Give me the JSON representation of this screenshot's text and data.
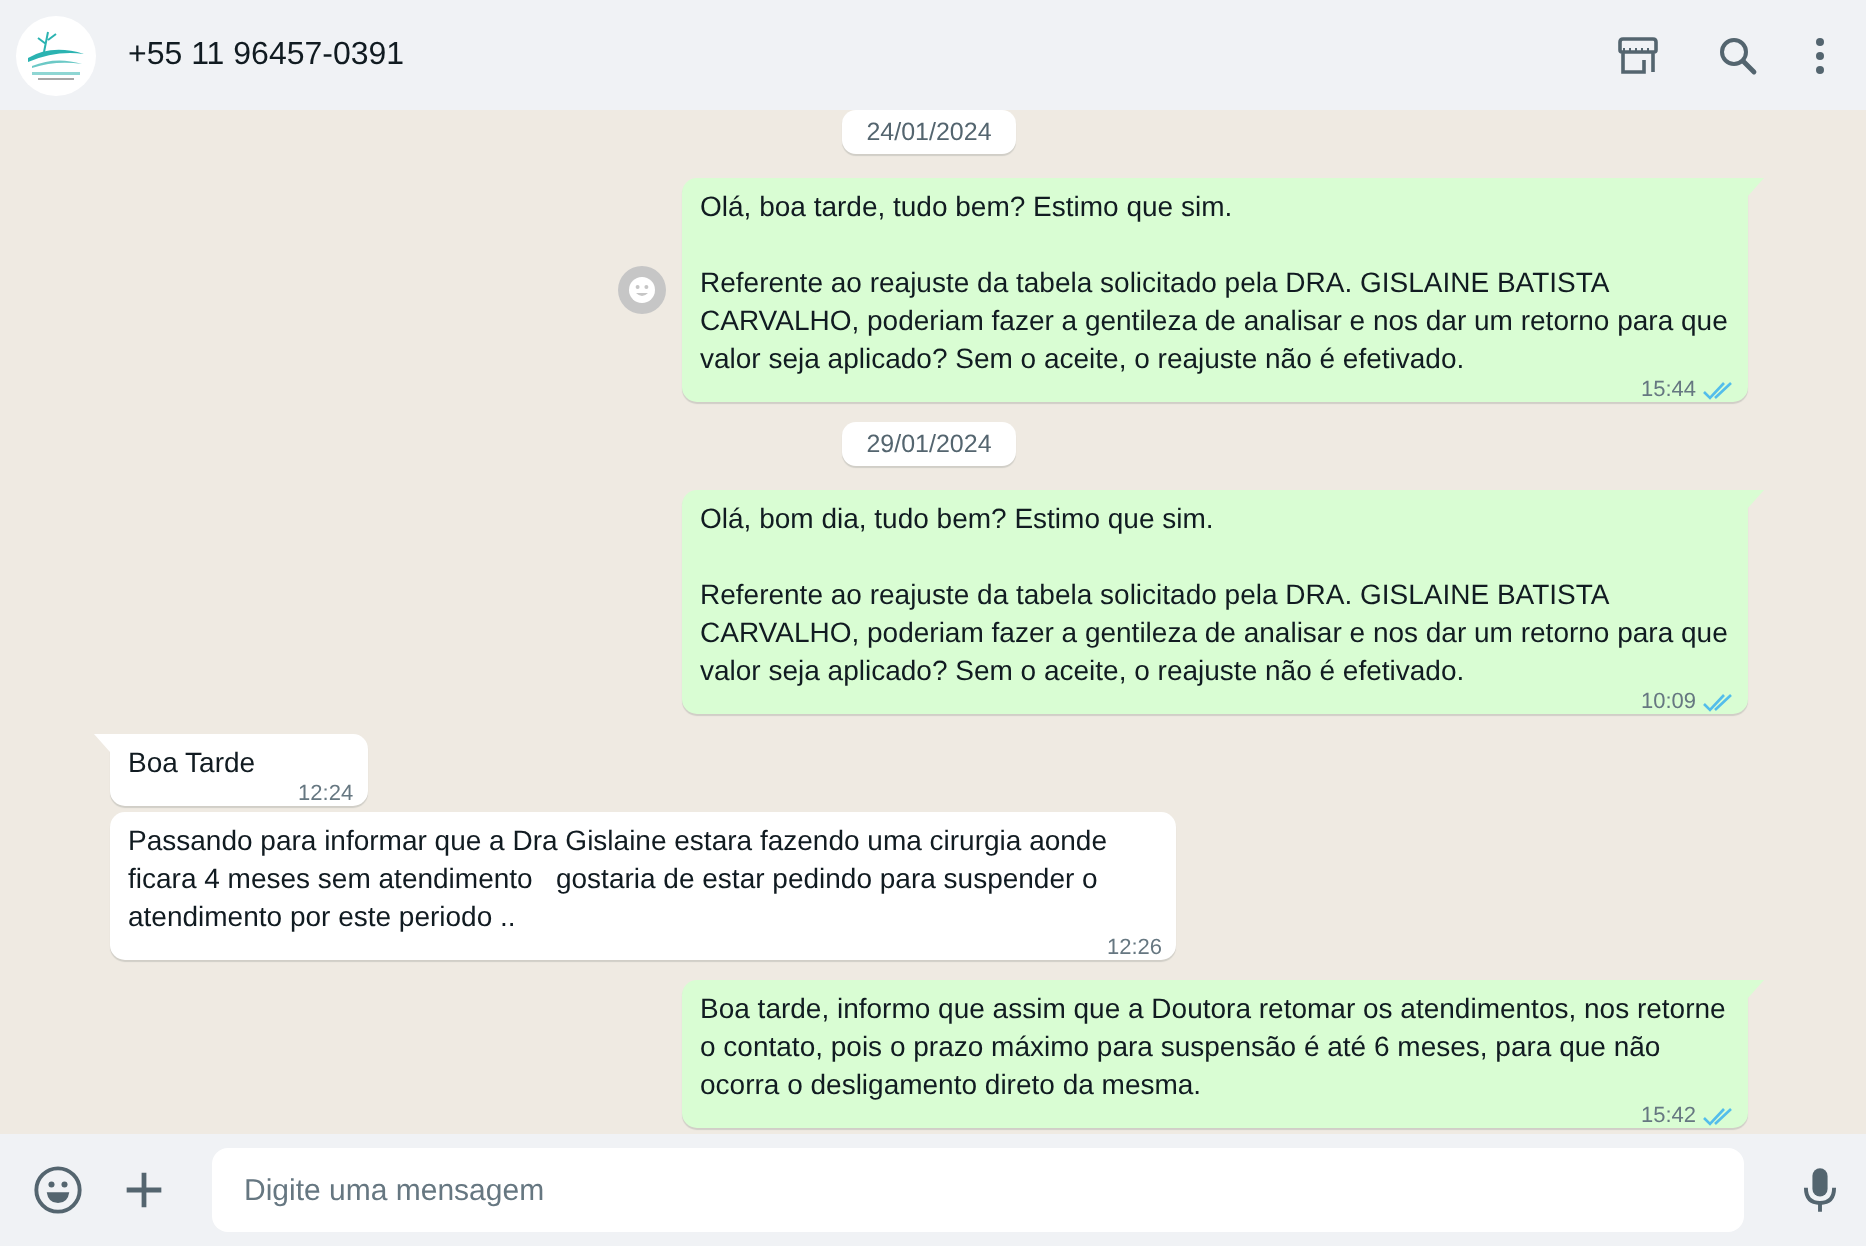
{
  "header": {
    "contact": "+55 11 96457-0391"
  },
  "messages": [
    {
      "kind": "date",
      "text": "24/01/2024"
    },
    {
      "kind": "out",
      "text": "Olá, boa tarde, tudo bem? Estimo que sim.\n\nReferente ao reajuste da tabela solicitado pela DRA. GISLAINE BATISTA CARVALHO, poderiam fazer a gentileza de analisar e nos dar um retorno para que valor seja aplicado? Sem o aceite, o reajuste não é efetivado.",
      "time": "15:44",
      "read": true,
      "reaction_button": true
    },
    {
      "kind": "date",
      "text": "29/01/2024"
    },
    {
      "kind": "out",
      "text": "Olá, bom dia, tudo bem? Estimo que sim.\n\nReferente ao reajuste da tabela solicitado pela DRA. GISLAINE BATISTA CARVALHO, poderiam fazer a gentileza de analisar e nos dar um retorno para que valor seja aplicado? Sem o aceite, o reajuste não é efetivado.",
      "time": "10:09",
      "read": true,
      "reaction_button": false
    },
    {
      "kind": "in",
      "text": "Boa Tarde",
      "time": "12:24"
    },
    {
      "kind": "in",
      "text": "Passando para informar que a Dra Gislaine estara fazendo uma cirurgia aonde ficara 4 meses sem atendimento   gostaria de estar pedindo para suspender o atendimento por este periodo ..",
      "time": "12:26"
    },
    {
      "kind": "out",
      "text": "Boa tarde, informo que assim que a Doutora retomar os atendimentos, nos retorne o contato, pois o prazo máximo para suspensão é até 6 meses, para que não ocorra o desligamento direto da mesma.",
      "time": "15:42",
      "read": true,
      "reaction_button": false
    }
  ],
  "composer": {
    "placeholder": "Digite uma mensagem"
  }
}
